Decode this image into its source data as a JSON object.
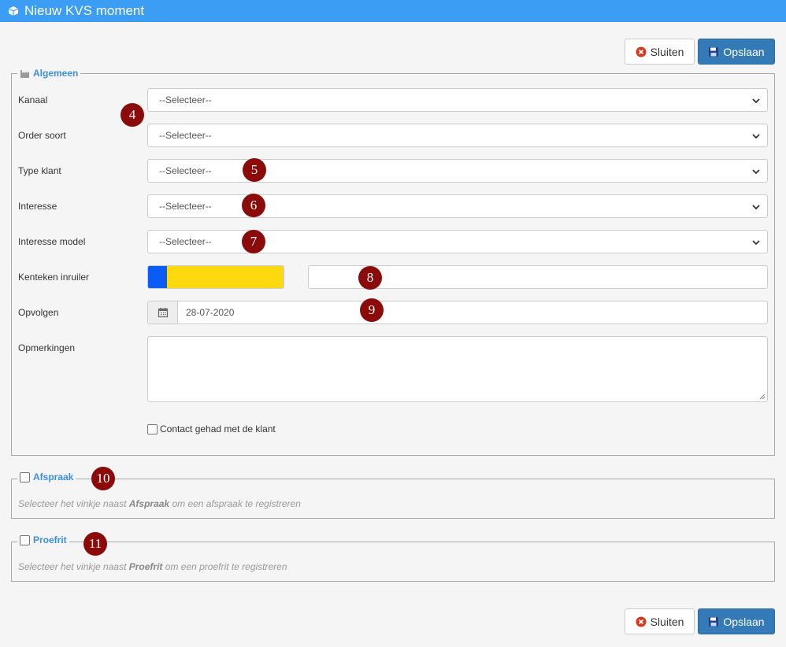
{
  "window": {
    "title": "Nieuw KVS moment"
  },
  "toolbar": {
    "close_label": "Sluiten",
    "save_label": "Opslaan"
  },
  "general": {
    "legend": "Algemeen",
    "fields": {
      "kanaal": {
        "label": "Kanaal",
        "value": "--Selecteer--"
      },
      "order_soort": {
        "label": "Order soort",
        "value": "--Selecteer--"
      },
      "type_klant": {
        "label": "Type klant",
        "value": "--Selecteer--"
      },
      "interesse": {
        "label": "Interesse",
        "value": "--Selecteer--"
      },
      "interesse_model": {
        "label": "Interesse model",
        "value": "--Selecteer--"
      },
      "kenteken": {
        "label": "Kenteken inruiler",
        "value": "",
        "plate_colors": [
          "#0a5cf5",
          "#ffd910"
        ]
      },
      "opvolgen": {
        "label": "Opvolgen",
        "value": "28-07-2020"
      },
      "opmerkingen": {
        "label": "Opmerkingen",
        "value": ""
      },
      "contact": {
        "label": "Contact gehad met de klant",
        "checked": false
      }
    }
  },
  "afspraak": {
    "legend": "Afspraak",
    "hint_pre": "Selecteer het vinkje naast ",
    "hint_bold": "Afspraak",
    "hint_post": " om een afspraak te registreren"
  },
  "proefrit": {
    "legend": "Proefrit",
    "hint_pre": "Selecteer het vinkje naast ",
    "hint_bold": "Proefrit",
    "hint_post": " om een proefrit te registreren"
  },
  "annotations": [
    "4",
    "5",
    "6",
    "7",
    "8",
    "9",
    "10",
    "11"
  ],
  "colors": {
    "header": "#3c9df5",
    "primary": "#337ab7",
    "legend": "#3a8ee6",
    "badge": "#8b0a0a"
  }
}
